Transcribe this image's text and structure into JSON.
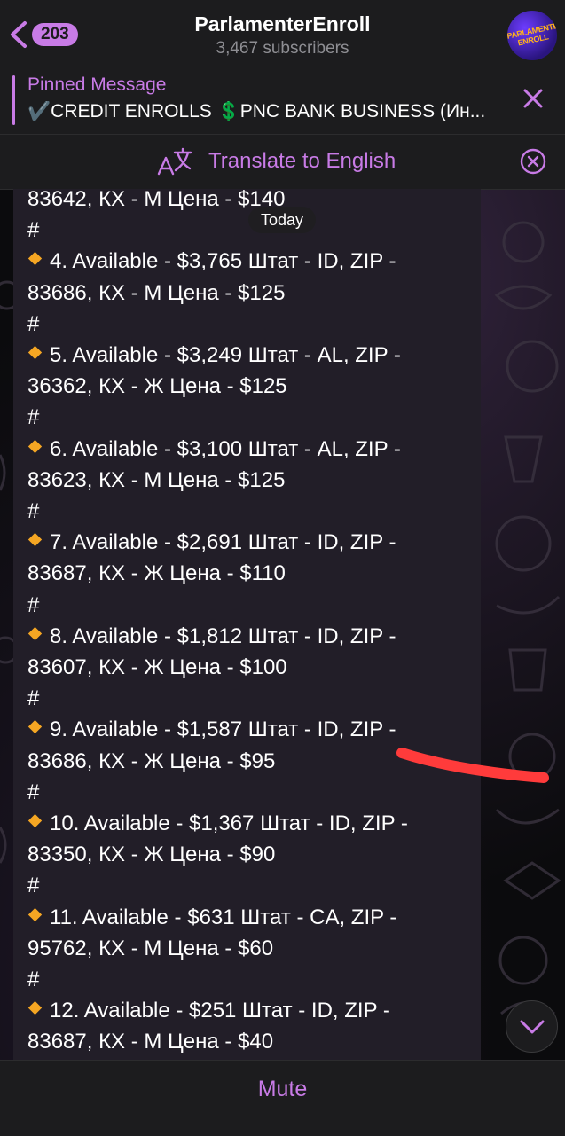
{
  "header": {
    "back_count": "203",
    "title": "ParlamenterEnroll",
    "subtitle": "3,467 subscribers",
    "avatar_text": "PARLAMENTER ENROLL"
  },
  "pinned": {
    "title": "Pinned Message",
    "text": "✔️CREDIT ENROLLS 💲PNC BANK BUSINESS (Ин..."
  },
  "translate": {
    "label": "Translate to English"
  },
  "date_badge": "Today",
  "message": {
    "lines": [
      "83642, КХ - М Цена - $140",
      "#",
      "4. Available - $3,765 Штат - ID, ZIP -",
      "83686, КХ - М Цена - $125",
      "#",
      "5. Available - $3,249 Штат - AL, ZIP -",
      "36362, КХ - Ж Цена - $125",
      "#",
      "6. Available - $3,100 Штат - AL, ZIP -",
      "83623, КХ - М Цена - $125",
      "#",
      "7. Available - $2,691 Штат - ID, ZIP -",
      "83687, КХ - Ж Цена - $110",
      "#",
      "8. Available - $1,812 Штат - ID, ZIP -",
      "83607, КХ - Ж Цена - $100",
      "#",
      "9. Available - $1,587 Штат - ID, ZIP -",
      "83686, КХ - Ж Цена - $95",
      "#",
      "10. Available - $1,367 Штат - ID, ZIP -",
      "83350, КХ - Ж Цена - $90",
      "#",
      "11. Available - $631 Штат - CA, ZIP -",
      "95762, КХ - М Цена - $60",
      "#",
      "12. Available - $251 Штат - ID, ZIP -",
      "83687, КХ - М Цена - $40"
    ]
  },
  "bottom": {
    "mute_label": "Mute"
  },
  "colors": {
    "accent": "#c87be6",
    "bubble": "#221e28",
    "bar": "#1c1c1e",
    "diamond": "#f5a623",
    "red_mark": "#ff3b3b"
  },
  "icons": [
    "back-chevron-icon",
    "close-icon",
    "translate-icon",
    "close-circle-icon",
    "diamond-icon",
    "chevron-down-icon"
  ]
}
